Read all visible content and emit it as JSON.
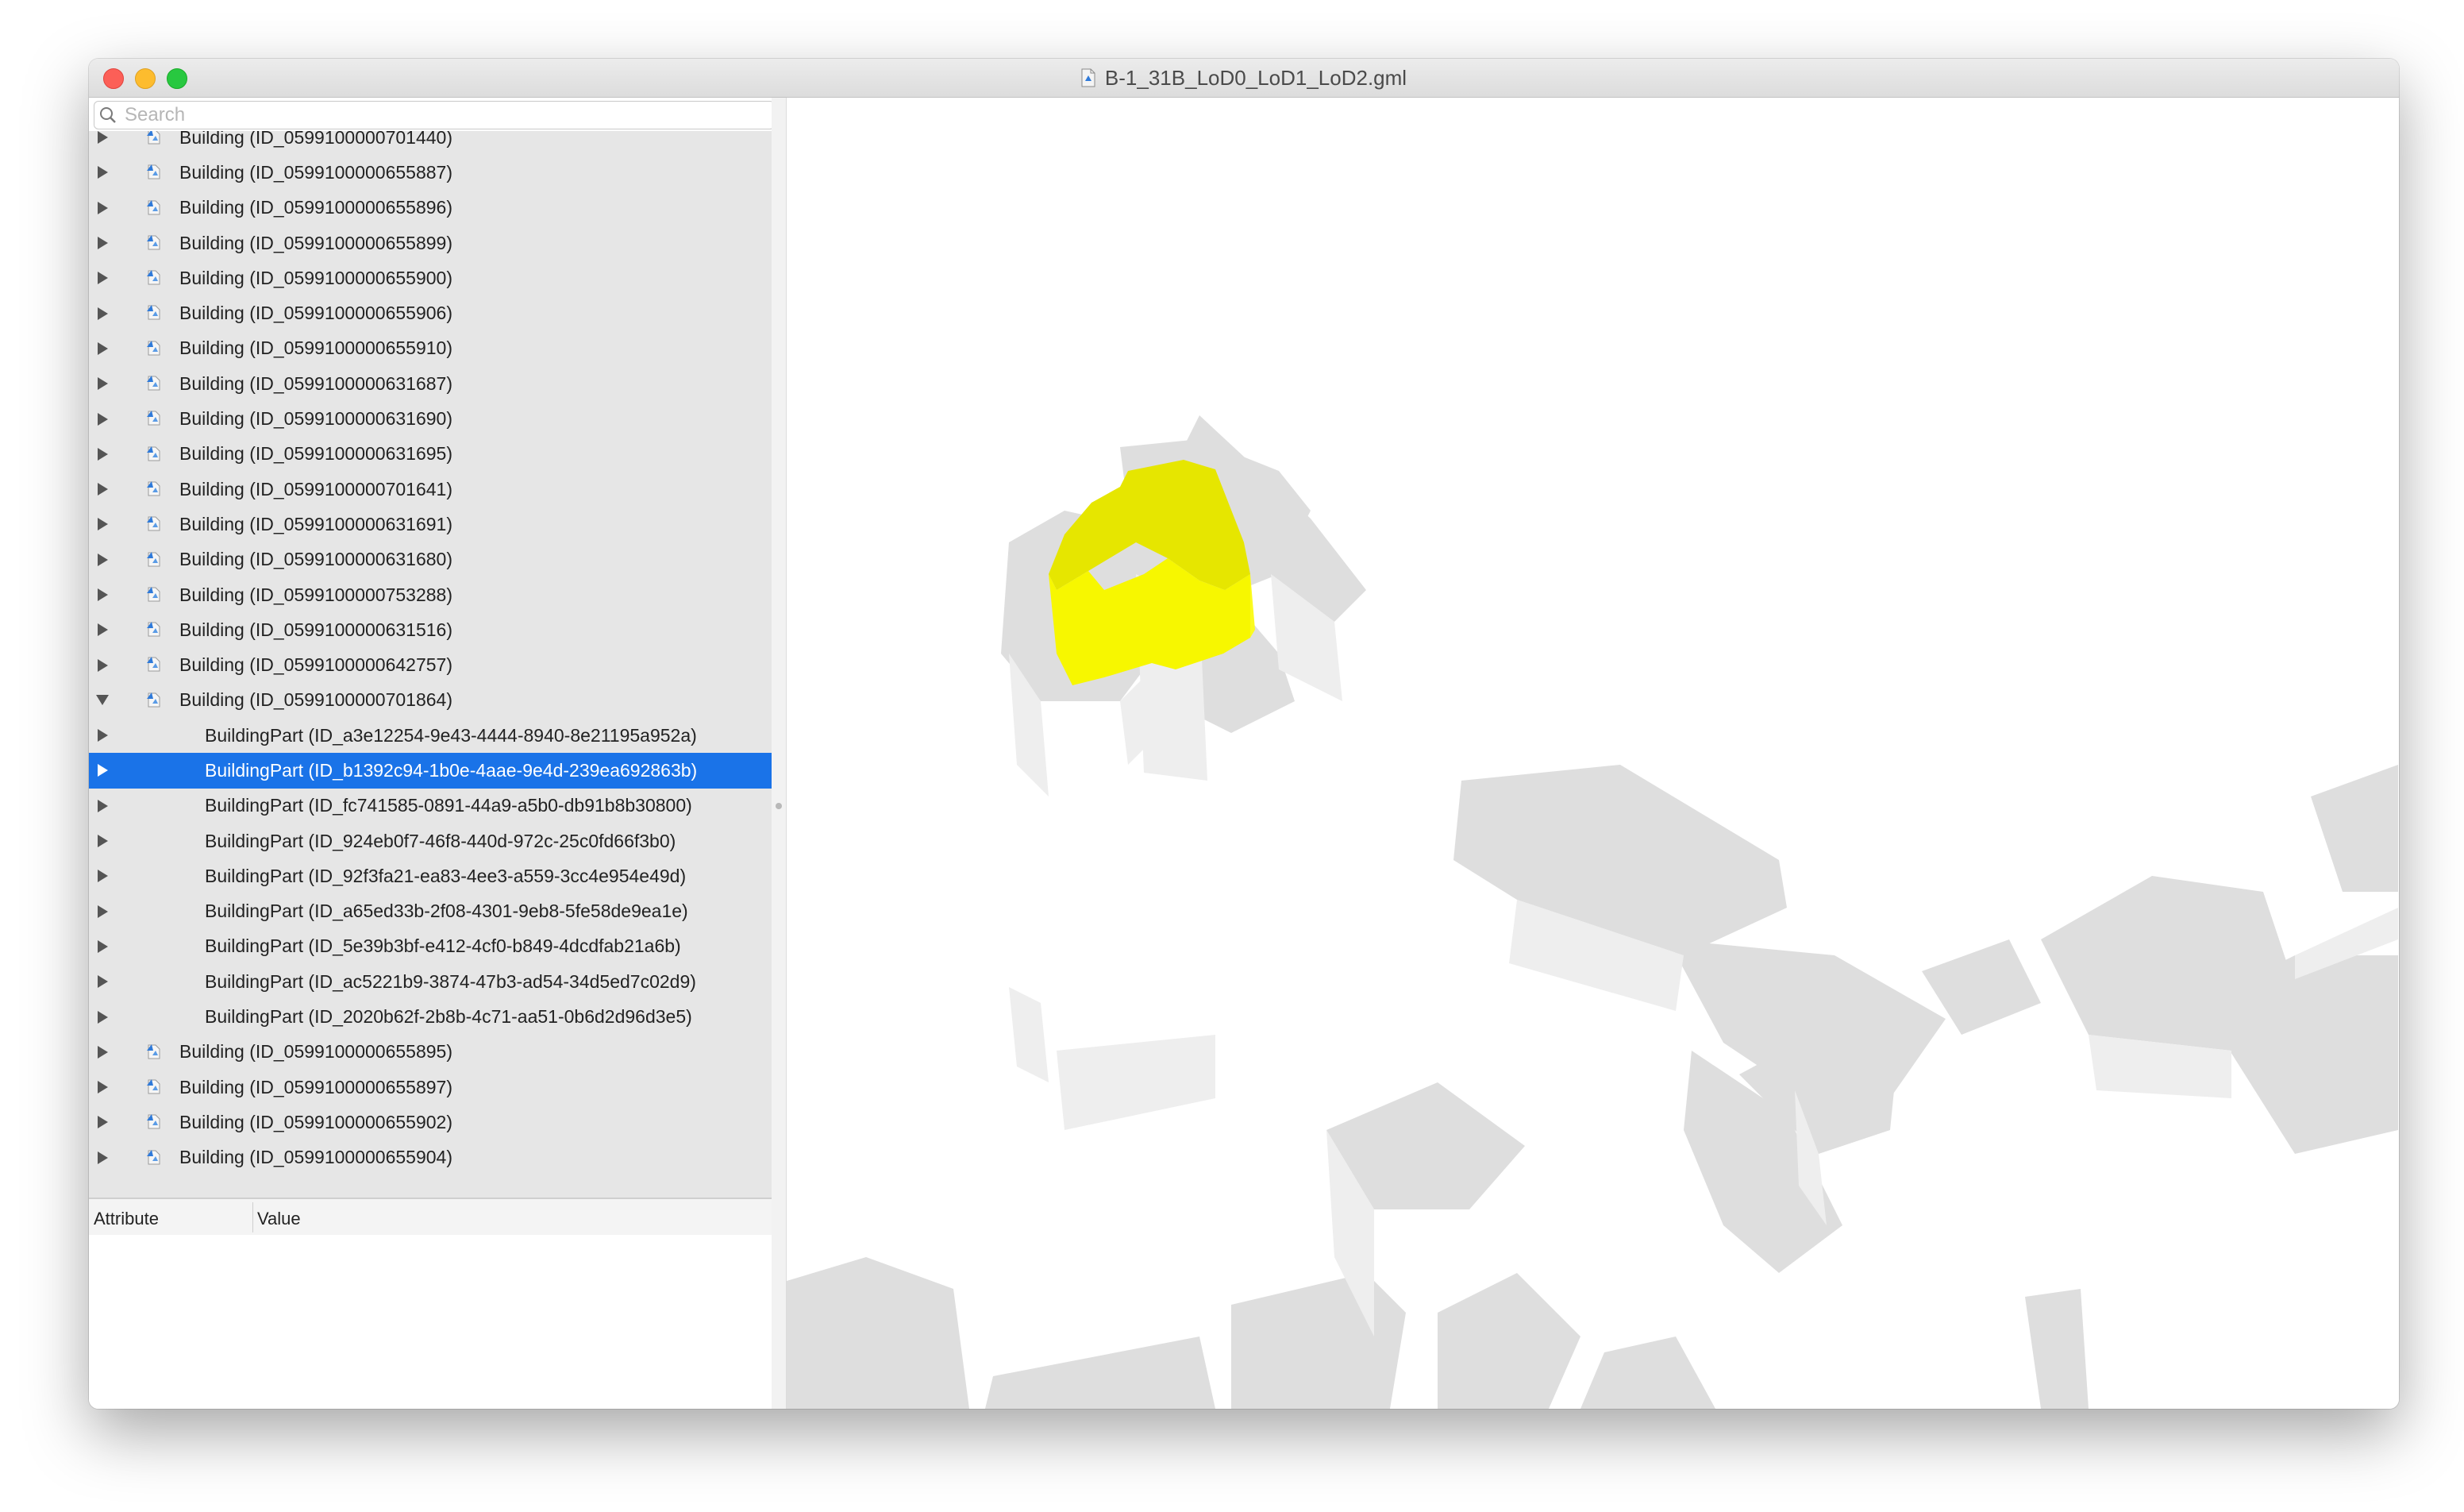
{
  "window": {
    "title": "B-1_31B_LoD0_LoD1_LoD2.gml",
    "title_icon": "gml-document-icon"
  },
  "search": {
    "placeholder": "Search",
    "value": ""
  },
  "tree": {
    "rows": [
      {
        "label": "Building (ID_0599100000701440)",
        "kind": "building",
        "expanded": false,
        "selected": false
      },
      {
        "label": "Building (ID_0599100000655887)",
        "kind": "building",
        "expanded": false,
        "selected": false
      },
      {
        "label": "Building (ID_0599100000655896)",
        "kind": "building",
        "expanded": false,
        "selected": false
      },
      {
        "label": "Building (ID_0599100000655899)",
        "kind": "building",
        "expanded": false,
        "selected": false
      },
      {
        "label": "Building (ID_0599100000655900)",
        "kind": "building",
        "expanded": false,
        "selected": false
      },
      {
        "label": "Building (ID_0599100000655906)",
        "kind": "building",
        "expanded": false,
        "selected": false
      },
      {
        "label": "Building (ID_0599100000655910)",
        "kind": "building",
        "expanded": false,
        "selected": false
      },
      {
        "label": "Building (ID_0599100000631687)",
        "kind": "building",
        "expanded": false,
        "selected": false
      },
      {
        "label": "Building (ID_0599100000631690)",
        "kind": "building",
        "expanded": false,
        "selected": false
      },
      {
        "label": "Building (ID_0599100000631695)",
        "kind": "building",
        "expanded": false,
        "selected": false
      },
      {
        "label": "Building (ID_0599100000701641)",
        "kind": "building",
        "expanded": false,
        "selected": false
      },
      {
        "label": "Building (ID_0599100000631691)",
        "kind": "building",
        "expanded": false,
        "selected": false
      },
      {
        "label": "Building (ID_0599100000631680)",
        "kind": "building",
        "expanded": false,
        "selected": false
      },
      {
        "label": "Building (ID_0599100000753288)",
        "kind": "building",
        "expanded": false,
        "selected": false
      },
      {
        "label": "Building (ID_0599100000631516)",
        "kind": "building",
        "expanded": false,
        "selected": false
      },
      {
        "label": "Building (ID_0599100000642757)",
        "kind": "building",
        "expanded": false,
        "selected": false
      },
      {
        "label": "Building (ID_0599100000701864)",
        "kind": "building",
        "expanded": true,
        "selected": false
      },
      {
        "label": "BuildingPart (ID_a3e12254-9e43-4444-8940-8e21195a952a)",
        "kind": "part",
        "expanded": false,
        "selected": false
      },
      {
        "label": "BuildingPart (ID_b1392c94-1b0e-4aae-9e4d-239ea692863b)",
        "kind": "part",
        "expanded": false,
        "selected": true
      },
      {
        "label": "BuildingPart (ID_fc741585-0891-44a9-a5b0-db91b8b30800)",
        "kind": "part",
        "expanded": false,
        "selected": false
      },
      {
        "label": "BuildingPart (ID_924eb0f7-46f8-440d-972c-25c0fd66f3b0)",
        "kind": "part",
        "expanded": false,
        "selected": false
      },
      {
        "label": "BuildingPart (ID_92f3fa21-ea83-4ee3-a559-3cc4e954e49d)",
        "kind": "part",
        "expanded": false,
        "selected": false
      },
      {
        "label": "BuildingPart (ID_a65ed33b-2f08-4301-9eb8-5fe58de9ea1e)",
        "kind": "part",
        "expanded": false,
        "selected": false
      },
      {
        "label": "BuildingPart (ID_5e39b3bf-e412-4cf0-b849-4dcdfab21a6b)",
        "kind": "part",
        "expanded": false,
        "selected": false
      },
      {
        "label": "BuildingPart (ID_ac5221b9-3874-47b3-ad54-34d5ed7c02d9)",
        "kind": "part",
        "expanded": false,
        "selected": false
      },
      {
        "label": "BuildingPart (ID_2020b62f-2b8b-4c71-aa51-0b6d2d96d3e5)",
        "kind": "part",
        "expanded": false,
        "selected": false
      },
      {
        "label": "Building (ID_0599100000655895)",
        "kind": "building",
        "expanded": false,
        "selected": false
      },
      {
        "label": "Building (ID_0599100000655897)",
        "kind": "building",
        "expanded": false,
        "selected": false
      },
      {
        "label": "Building (ID_0599100000655902)",
        "kind": "building",
        "expanded": false,
        "selected": false
      },
      {
        "label": "Building (ID_0599100000655904)",
        "kind": "building",
        "expanded": false,
        "selected": false
      }
    ]
  },
  "attributes": {
    "col_attribute": "Attribute",
    "col_value": "Value",
    "rows": []
  },
  "viewer": {
    "highlight_color": "#f0f000",
    "building_color": "#e2e2e2",
    "building_top_color": "#d6d6d6",
    "building_side_color": "#eeeeee"
  }
}
